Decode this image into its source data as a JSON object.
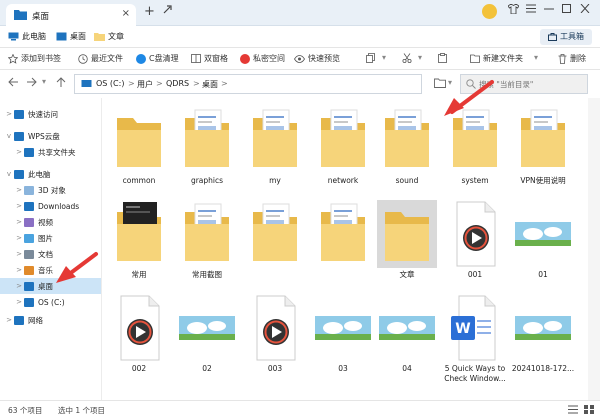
{
  "window": {
    "tab_title": "桌面",
    "tab_close": "×",
    "new_tab": "+",
    "colors": {
      "accent": "#1e73be",
      "folder": "#f6d47a",
      "selected": "#cce4f7",
      "arrow": "#e53935"
    }
  },
  "quickbar": {
    "this_pc": "此电脑",
    "desktop": "桌面",
    "documents": "文章",
    "toolbox": "工具箱"
  },
  "commands": {
    "bookmark": "添加到书签",
    "recent": "最近文件",
    "c_clean": "C盘清理",
    "dual_pane": "双窗格",
    "private": "私密空间",
    "preview": "快速预览",
    "new_folder": "新建文件夹",
    "delete": "删除"
  },
  "address": {
    "parts": [
      "OS (C:)",
      "用户",
      "QDRS",
      "桌面"
    ],
    "separator": ">",
    "search_placeholder": "搜索 \"当前目录\""
  },
  "sidebar": {
    "items": [
      {
        "label": "快速访问",
        "chev": ">",
        "icon": "star-icon"
      },
      {
        "label": "WPS云盘",
        "chev": "v",
        "icon": "cloud-icon"
      },
      {
        "label": "共享文件夹",
        "chev": ">",
        "icon": "share-icon"
      },
      {
        "label": "此电脑",
        "chev": "v",
        "icon": "computer-icon"
      },
      {
        "label": "3D 对象",
        "chev": ">",
        "icon": "cube-icon"
      },
      {
        "label": "Downloads",
        "chev": ">",
        "icon": "download-icon"
      },
      {
        "label": "视频",
        "chev": ">",
        "icon": "video-icon"
      },
      {
        "label": "图片",
        "chev": ">",
        "icon": "picture-icon"
      },
      {
        "label": "文档",
        "chev": ">",
        "icon": "document-icon"
      },
      {
        "label": "音乐",
        "chev": ">",
        "icon": "music-icon"
      },
      {
        "label": "桌面",
        "chev": ">",
        "icon": "desktop-icon"
      },
      {
        "label": "OS (C:)",
        "chev": ">",
        "icon": "drive-icon"
      },
      {
        "label": "网络",
        "chev": ">",
        "icon": "network-icon"
      }
    ]
  },
  "files": [
    {
      "name": "common",
      "kind": "folder"
    },
    {
      "name": "graphics",
      "kind": "folder-doc"
    },
    {
      "name": "my",
      "kind": "folder-doc"
    },
    {
      "name": "network",
      "kind": "folder-doc"
    },
    {
      "name": "sound",
      "kind": "folder-doc"
    },
    {
      "name": "system",
      "kind": "folder-doc"
    },
    {
      "name": "VPN使用说明",
      "kind": "folder-doc"
    },
    {
      "name": "常用",
      "kind": "folder-dark"
    },
    {
      "name": "常用截图",
      "kind": "folder-doc"
    },
    {
      "name": "",
      "kind": "folder-doc"
    },
    {
      "name": "",
      "kind": "folder-doc"
    },
    {
      "name": "文章",
      "kind": "folder"
    },
    {
      "name": "001",
      "kind": "video"
    },
    {
      "name": "01",
      "kind": "image"
    },
    {
      "name": "002",
      "kind": "video"
    },
    {
      "name": "02",
      "kind": "image"
    },
    {
      "name": "003",
      "kind": "video"
    },
    {
      "name": "03",
      "kind": "image"
    },
    {
      "name": "04",
      "kind": "image"
    },
    {
      "name": "5 Quick Ways to Check Window...",
      "kind": "word"
    },
    {
      "name": "20241018-172...",
      "kind": "image"
    }
  ],
  "status": {
    "count": "63 个项目",
    "selected": "选中 1 个项目"
  }
}
